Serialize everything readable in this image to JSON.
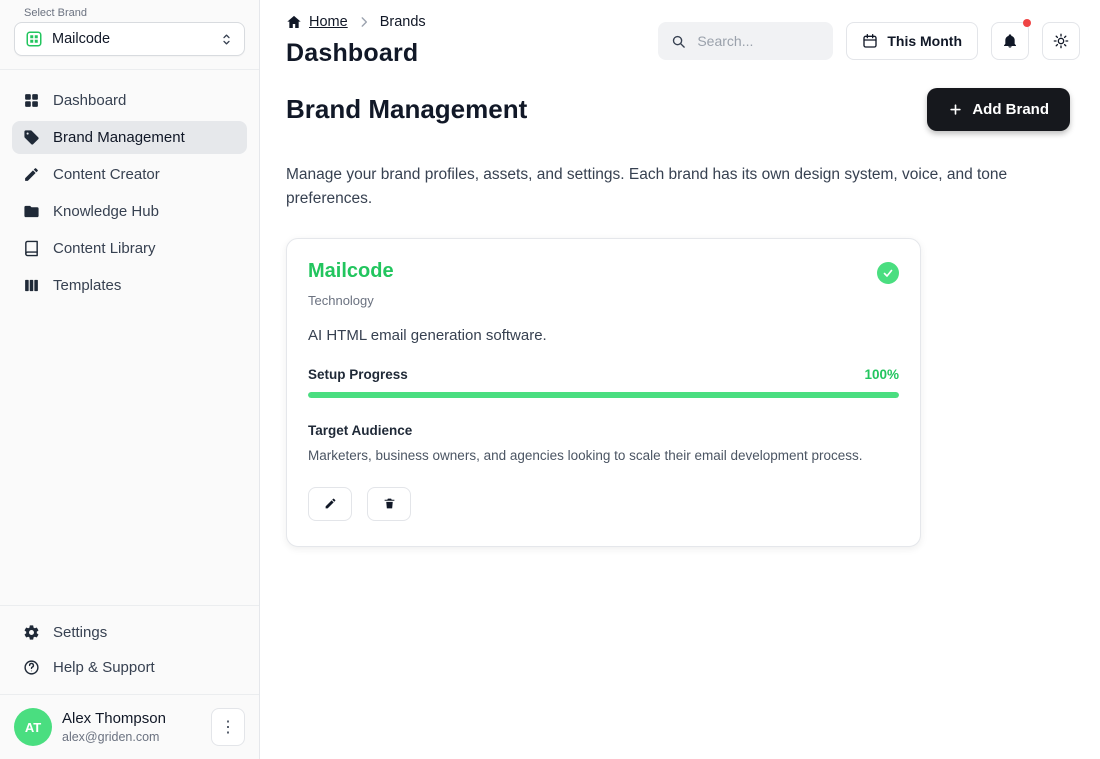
{
  "sidebar": {
    "select_brand_label": "Select Brand",
    "brand_selector": {
      "value": "Mailcode",
      "icon": "brand-grid-icon"
    },
    "nav": [
      {
        "label": "Dashboard",
        "icon": "dashboard-icon",
        "active": false
      },
      {
        "label": "Brand Management",
        "icon": "brand-tag-icon",
        "active": true
      },
      {
        "label": "Content Creator",
        "icon": "pencil-icon",
        "active": false
      },
      {
        "label": "Knowledge Hub",
        "icon": "folder-icon",
        "active": false
      },
      {
        "label": "Content Library",
        "icon": "book-icon",
        "active": false
      },
      {
        "label": "Templates",
        "icon": "columns-icon",
        "active": false
      }
    ],
    "footer_nav": [
      {
        "label": "Settings",
        "icon": "gear-icon"
      },
      {
        "label": "Help & Support",
        "icon": "help-circle-icon"
      }
    ],
    "user": {
      "initials": "AT",
      "name": "Alex Thompson",
      "email": "alex@griden.com"
    }
  },
  "header": {
    "breadcrumb": {
      "home": "Home",
      "current": "Brands"
    },
    "page_title": "Dashboard",
    "search": {
      "placeholder": "Search..."
    },
    "period_button_label": "This Month",
    "notification": {
      "has_unread": true
    }
  },
  "main": {
    "section_title": "Brand Management",
    "add_brand_label": "Add Brand",
    "description": "Manage your brand profiles, assets, and settings. Each brand has its own design system, voice, and tone preferences.",
    "brand_card": {
      "name": "Mailcode",
      "category": "Technology",
      "description": "AI HTML email generation software.",
      "setup_progress_label": "Setup Progress",
      "setup_progress_text": "100%",
      "setup_progress_percent": 100,
      "target_audience_label": "Target Audience",
      "target_audience": "Marketers, business owners, and agencies looking to scale their email development process.",
      "verified": true
    }
  },
  "colors": {
    "accent_green": "#22c55e",
    "progress_green": "#4ade80",
    "dark_button": "#16181d",
    "notification_red": "#ef4444"
  }
}
